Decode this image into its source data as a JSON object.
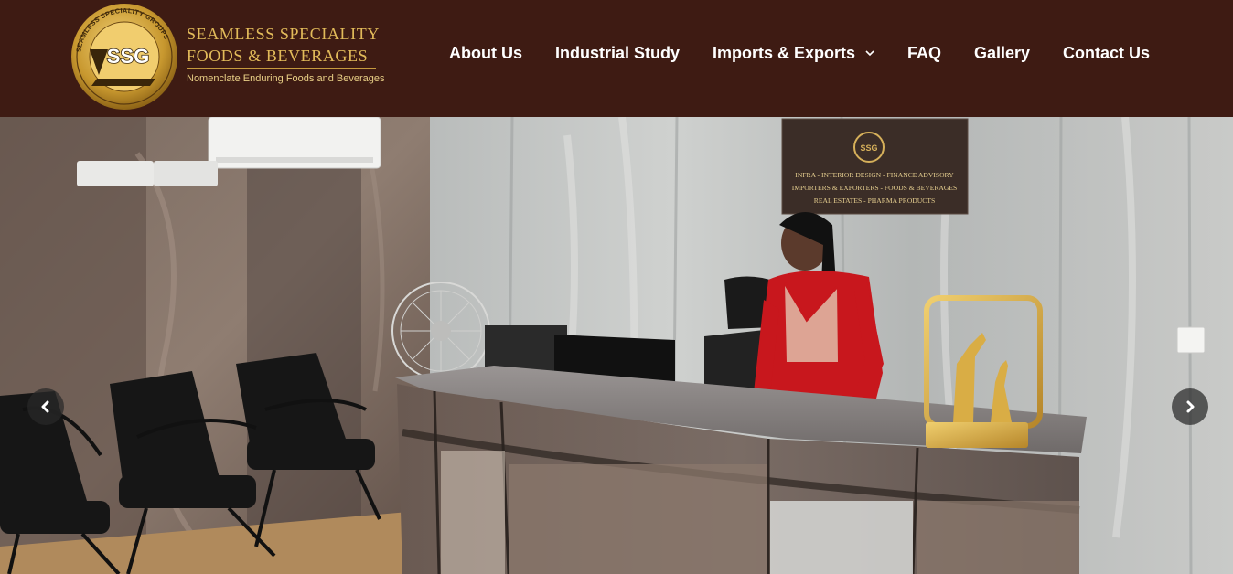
{
  "brand": {
    "badge_text": "SSG",
    "badge_ring_text": "SEAMLESS SPECIALITY GROUPS",
    "name_line1": "SEAMLESS SPECIALITY",
    "name_line2": "FOODS & BEVERAGES",
    "tagline": "Nomenclate Enduring Foods and Beverages",
    "gold": "#e2bb5a",
    "header_bg": "#3e1b13"
  },
  "nav": {
    "items": [
      {
        "label": "About Us"
      },
      {
        "label": "Industrial Study"
      },
      {
        "label": "Imports & Exports",
        "has_dropdown": true
      },
      {
        "label": "FAQ"
      },
      {
        "label": "Gallery"
      },
      {
        "label": "Contact Us"
      }
    ]
  },
  "hero": {
    "wall_sign": {
      "line1": "INFRA - INTERIOR DESIGN - FINANCE ADVISORY",
      "line2": "IMPORTERS & EXPORTERS - FOODS & BEVERAGES",
      "line3": "REAL ESTATES - PHARMA PRODUCTS"
    },
    "controls": {
      "prev_icon": "chevron-left-icon",
      "next_icon": "chevron-right-icon"
    }
  }
}
